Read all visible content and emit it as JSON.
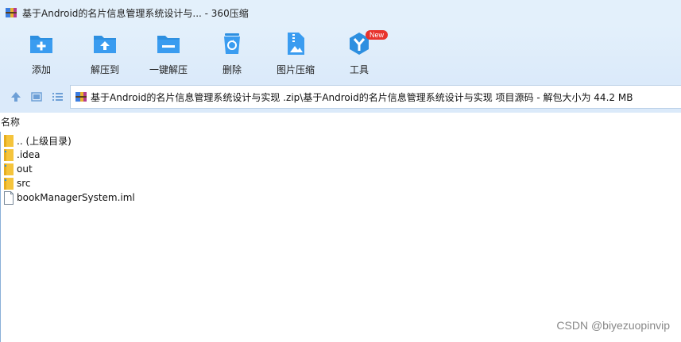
{
  "window": {
    "title": "基于Android的名片信息管理系统设计与... - 360压缩"
  },
  "toolbar": {
    "buttons": [
      {
        "label": "添加",
        "icon": "add-folder-icon"
      },
      {
        "label": "解压到",
        "icon": "extract-to-icon"
      },
      {
        "label": "一键解压",
        "icon": "one-click-extract-icon"
      },
      {
        "label": "删除",
        "icon": "trash-icon"
      },
      {
        "label": "图片压缩",
        "icon": "image-compress-icon"
      },
      {
        "label": "工具",
        "icon": "tools-icon",
        "badge": "New"
      }
    ]
  },
  "address": {
    "path": "基于Android的名片信息管理系统设计与实现 .zip\\基于Android的名片信息管理系统设计与实现 项目源码 - 解包大小为 44.2 MB"
  },
  "list": {
    "header_name": "名称",
    "items": [
      {
        "name": ".. (上级目录)",
        "type": "folder"
      },
      {
        "name": ".idea",
        "type": "folder"
      },
      {
        "name": "out",
        "type": "folder"
      },
      {
        "name": "src",
        "type": "folder"
      },
      {
        "name": "bookManagerSystem.iml",
        "type": "file"
      }
    ]
  },
  "watermark": "CSDN @biyezuopinvip",
  "colors": {
    "accent": "#2d8fe0",
    "chrome": "#dbeafa",
    "folder": "#f5c43c",
    "badge": "#e8332d"
  }
}
